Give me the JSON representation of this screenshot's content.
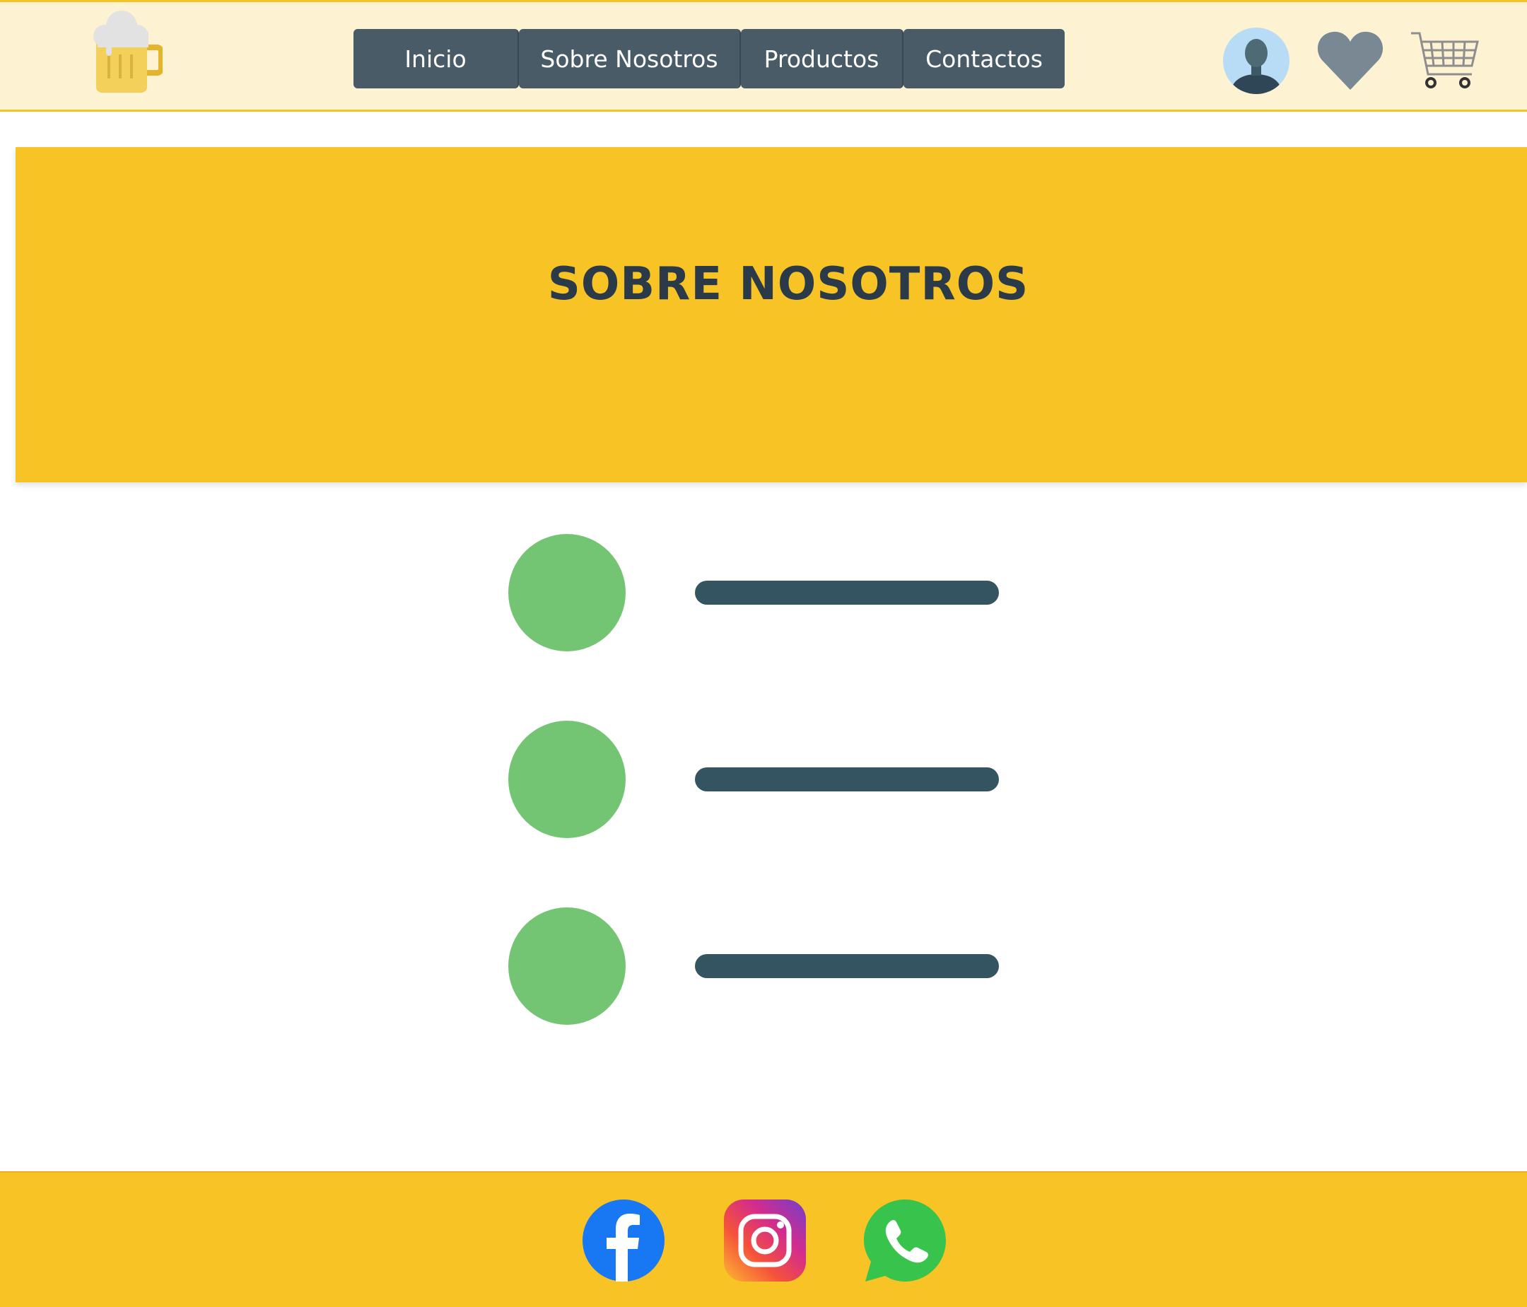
{
  "header": {
    "logo_icon": "beer-mug-icon",
    "nav": [
      {
        "label": "Inicio"
      },
      {
        "label": "Sobre Nosotros"
      },
      {
        "label": "Productos"
      },
      {
        "label": "Contactos"
      }
    ],
    "icons": [
      "user-avatar-icon",
      "heart-icon",
      "shopping-cart-icon"
    ]
  },
  "banner": {
    "title": "SOBRE NOSOTROS"
  },
  "list": {
    "items": [
      {
        "icon": "green-circle"
      },
      {
        "icon": "green-circle"
      },
      {
        "icon": "green-circle"
      }
    ]
  },
  "footer": {
    "social": [
      "facebook-icon",
      "instagram-icon",
      "whatsapp-icon"
    ]
  },
  "colors": {
    "header_bg": "#fdf3d2",
    "accent": "#f7c325",
    "nav_bg": "#4a5b68",
    "title_text": "#2b3a48",
    "dot": "#73c473",
    "bar": "#345462"
  }
}
